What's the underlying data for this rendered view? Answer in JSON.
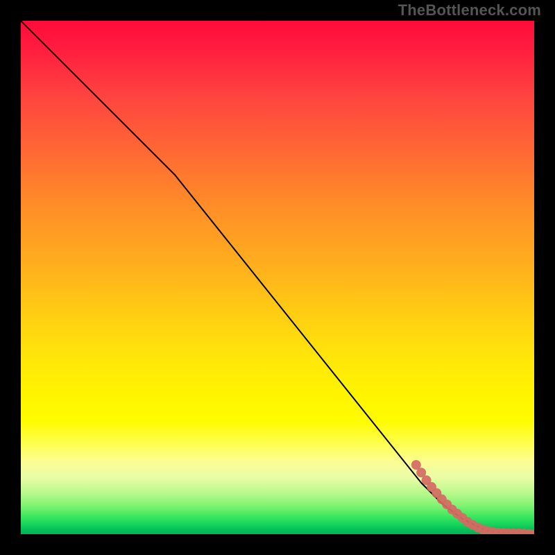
{
  "watermark": "TheBottleneck.com",
  "chart_data": {
    "type": "line",
    "title": "",
    "xlabel": "",
    "ylabel": "",
    "xlim": [
      0,
      100
    ],
    "ylim": [
      0,
      100
    ],
    "grid": false,
    "legend": false,
    "series": [
      {
        "name": "curve",
        "color": "#000000",
        "x": [
          0,
          10,
          15,
          20,
          25,
          30,
          40,
          50,
          60,
          70,
          78,
          82,
          86,
          90,
          92,
          94,
          96,
          98,
          100
        ],
        "y": [
          100,
          90,
          85,
          80,
          75,
          70,
          57.5,
          45,
          32.5,
          20,
          10,
          6,
          3,
          1,
          0.5,
          0.3,
          0.2,
          0.1,
          0
        ]
      },
      {
        "name": "cluster-dots",
        "color": "#d46a63",
        "type": "scatter",
        "points": [
          {
            "x": 77,
            "y": 13.5
          },
          {
            "x": 78,
            "y": 12.0
          },
          {
            "x": 79,
            "y": 10.5
          },
          {
            "x": 80,
            "y": 9.2
          },
          {
            "x": 81,
            "y": 8.0
          },
          {
            "x": 82,
            "y": 6.8
          },
          {
            "x": 83,
            "y": 5.8
          },
          {
            "x": 84,
            "y": 4.8
          },
          {
            "x": 85,
            "y": 4.0
          },
          {
            "x": 86,
            "y": 3.2
          },
          {
            "x": 87,
            "y": 2.4
          },
          {
            "x": 88,
            "y": 1.8
          },
          {
            "x": 89,
            "y": 1.3
          },
          {
            "x": 90,
            "y": 0.9
          },
          {
            "x": 91,
            "y": 0.6
          },
          {
            "x": 92,
            "y": 0.4
          },
          {
            "x": 93,
            "y": 0.3
          },
          {
            "x": 94,
            "y": 0.25
          },
          {
            "x": 95,
            "y": 0.2
          },
          {
            "x": 96,
            "y": 0.18
          },
          {
            "x": 97,
            "y": 0.15
          },
          {
            "x": 98,
            "y": 0.1
          },
          {
            "x": 99,
            "y": 0.05
          },
          {
            "x": 100,
            "y": 0.0
          }
        ]
      }
    ],
    "background_gradient": {
      "direction": "top-to-bottom",
      "stops": [
        {
          "pos": 0,
          "color": "#ff0b3a"
        },
        {
          "pos": 26,
          "color": "#ff6a33"
        },
        {
          "pos": 58,
          "color": "#ffd012"
        },
        {
          "pos": 78,
          "color": "#fffc00"
        },
        {
          "pos": 92,
          "color": "#b8f98b"
        },
        {
          "pos": 100,
          "color": "#00b556"
        }
      ]
    }
  }
}
